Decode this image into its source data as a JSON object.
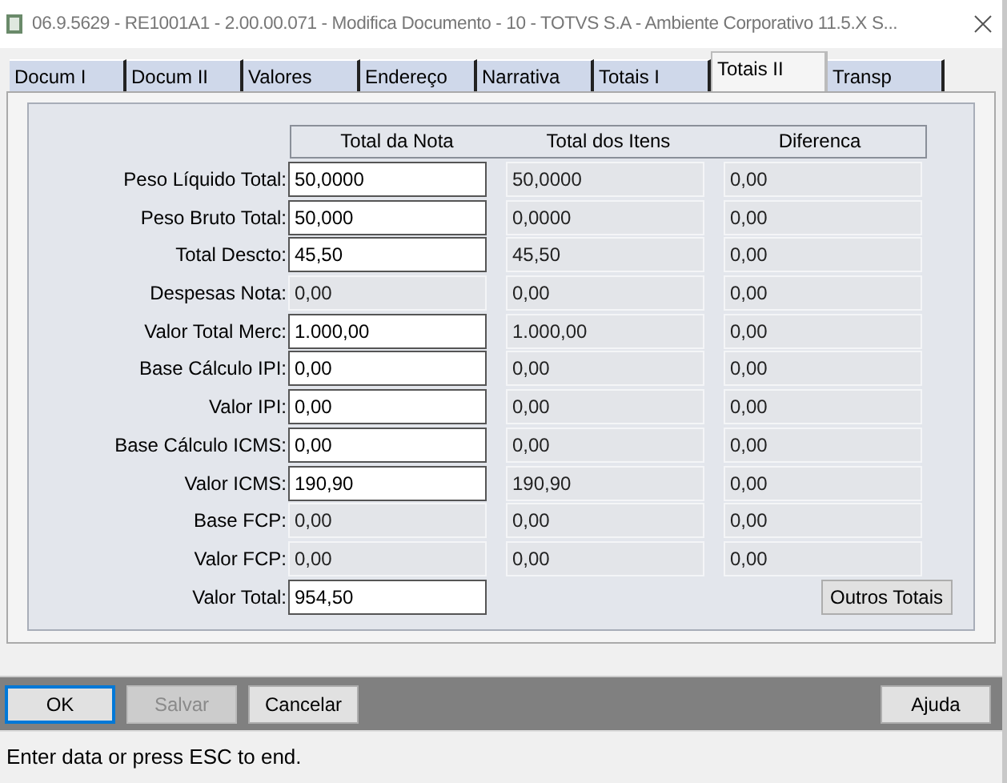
{
  "window": {
    "title": "06.9.5629 - RE1001A1 - 2.00.00.071 - Modifica Documento - 10 - TOTVS S.A - Ambiente Corporativo 11.5.X S..."
  },
  "tabs": [
    {
      "label": "Docum I",
      "selected": false
    },
    {
      "label": "Docum II",
      "selected": false
    },
    {
      "label": "Valores",
      "selected": false
    },
    {
      "label": "Endereço",
      "selected": false
    },
    {
      "label": "Narrativa",
      "selected": false
    },
    {
      "label": "Totais I",
      "selected": false
    },
    {
      "label": "Totais II",
      "selected": true
    },
    {
      "label": "Transp",
      "selected": false
    }
  ],
  "table": {
    "columns": [
      "Total da Nota",
      "Total dos Itens",
      "Diferenca"
    ],
    "rows": [
      {
        "label": "Peso Líquido Total:",
        "cells": [
          {
            "value": "50,0000",
            "disabled": false
          },
          {
            "value": "50,0000",
            "disabled": true
          },
          {
            "value": "0,00",
            "disabled": true
          }
        ]
      },
      {
        "label": "Peso Bruto Total:",
        "cells": [
          {
            "value": "50,000",
            "disabled": false
          },
          {
            "value": "0,0000",
            "disabled": true
          },
          {
            "value": "0,00",
            "disabled": true
          }
        ]
      },
      {
        "label": "Total Descto:",
        "cells": [
          {
            "value": "45,50",
            "disabled": false
          },
          {
            "value": "45,50",
            "disabled": true
          },
          {
            "value": "0,00",
            "disabled": true
          }
        ]
      },
      {
        "label": "Despesas Nota:",
        "cells": [
          {
            "value": "0,00",
            "disabled": true
          },
          {
            "value": "0,00",
            "disabled": true
          },
          {
            "value": "0,00",
            "disabled": true
          }
        ]
      },
      {
        "label": "Valor Total Merc:",
        "cells": [
          {
            "value": "1.000,00",
            "disabled": false
          },
          {
            "value": "1.000,00",
            "disabled": true
          },
          {
            "value": "0,00",
            "disabled": true
          }
        ]
      },
      {
        "label": "Base Cálculo IPI:",
        "cells": [
          {
            "value": "0,00",
            "disabled": false
          },
          {
            "value": "0,00",
            "disabled": true
          },
          {
            "value": "0,00",
            "disabled": true
          }
        ]
      },
      {
        "label": "Valor IPI:",
        "cells": [
          {
            "value": "0,00",
            "disabled": false
          },
          {
            "value": "0,00",
            "disabled": true
          },
          {
            "value": "0,00",
            "disabled": true
          }
        ]
      },
      {
        "label": "Base Cálculo ICMS:",
        "cells": [
          {
            "value": "0,00",
            "disabled": false
          },
          {
            "value": "0,00",
            "disabled": true
          },
          {
            "value": "0,00",
            "disabled": true
          }
        ]
      },
      {
        "label": "Valor ICMS:",
        "cells": [
          {
            "value": "190,90",
            "disabled": false
          },
          {
            "value": "190,90",
            "disabled": true
          },
          {
            "value": "0,00",
            "disabled": true
          }
        ]
      },
      {
        "label": "Base FCP:",
        "cells": [
          {
            "value": "0,00",
            "disabled": true
          },
          {
            "value": "0,00",
            "disabled": true
          },
          {
            "value": "0,00",
            "disabled": true
          }
        ]
      },
      {
        "label": "Valor FCP:",
        "cells": [
          {
            "value": "0,00",
            "disabled": true
          },
          {
            "value": "0,00",
            "disabled": true
          },
          {
            "value": "0,00",
            "disabled": true
          }
        ]
      },
      {
        "label": "Valor Total:",
        "cells": [
          {
            "value": "954,50",
            "disabled": false
          }
        ]
      }
    ],
    "side_button": "Outros Totais"
  },
  "buttons": [
    {
      "label": "OK",
      "focused": true,
      "disabled": false
    },
    {
      "label": "Salvar",
      "focused": false,
      "disabled": true
    },
    {
      "label": "Cancelar",
      "focused": false,
      "disabled": false
    }
  ],
  "help_button": "Ajuda",
  "status_bar": "Enter data or press ESC to end."
}
